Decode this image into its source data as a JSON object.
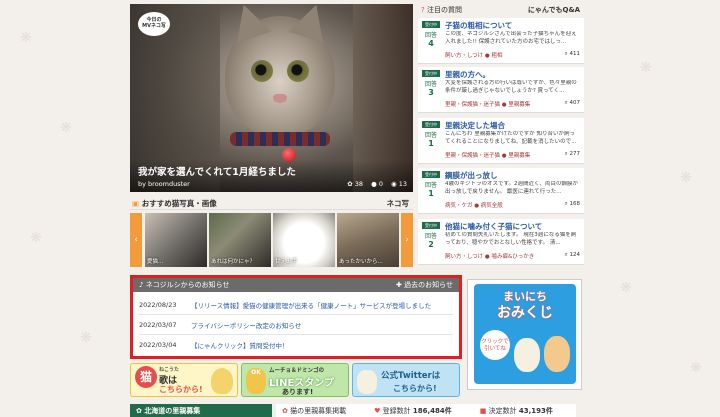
{
  "hero": {
    "badge_line1": "今日の",
    "badge_line2": "MVネコ写",
    "title": "我が家を選んでくれて1月経ちました",
    "author": "by broomduster",
    "likes": "38",
    "comments": "0",
    "views": "13"
  },
  "recommended": {
    "heading": "おすすめ猫写真・画像",
    "right_label": "ネコ写",
    "thumbs": [
      {
        "label": "愛猫..."
      },
      {
        "label": "あれは何かにゃ？"
      },
      {
        "label": "甘え上手"
      },
      {
        "label": "あったかいから..."
      }
    ]
  },
  "notice": {
    "heading": "ネコジルシからのお知らせ",
    "archive": "過去のお知らせ",
    "items": [
      {
        "date": "2022/08/23",
        "text": "【リリース情報】愛猫の健康管理が出来る「健康ノート」サービスが登場しました"
      },
      {
        "date": "2022/03/07",
        "text": "プライバシーポリシー改定のお知らせ"
      },
      {
        "date": "2022/03/04",
        "text": "【にゃんクリック】質問受付中！"
      }
    ]
  },
  "banners": {
    "b1_big": "猫",
    "b1_small": "ねこうた",
    "b1_line1": "歌は",
    "b1_line2": "こちらから!",
    "b2_line1": "ムーチョ＆ドミンゴの",
    "b2_line2": "LINEスタンプ",
    "b2_line3": "あります!",
    "b2_ok": "OK",
    "b3_line1": "公式Twitterは",
    "b3_line2": "こちらから!"
  },
  "bottom": {
    "area": "北海道の里親募集",
    "stat1_label": "猫の里親募集掲載",
    "stat2_label": "登録数計",
    "stat2_value": "186,484件",
    "stat3_label": "決定数計",
    "stat3_value": "43,193件"
  },
  "qa": {
    "heading": "注目の質問",
    "right_label": "にゃんでもQ&A",
    "status_label": "受付中",
    "answer_label": "回答",
    "items": [
      {
        "title": "子猫の粗相について",
        "body": "この度、ネコジルシさんで出会った子猫ちゃんを迎え入れました!! 保護されていた方のお宅ではしっ...",
        "category": "飼い方・しつけ ● 粗相",
        "answers": "4",
        "views": "411"
      },
      {
        "title": "里親の方へ。",
        "body": "大変を保護される方の行いは尊いですが、色々里親の条件が厳し過ぎじゃないでしょうか? 賞ってく...",
        "category": "里親・保護猫・迷子猫 ● 里親募集",
        "answers": "3",
        "views": "407"
      },
      {
        "title": "里親決定した場合",
        "body": "こんにちわ 里親募集かけたのですが 知り合いが飼ってくれることになりましてね、記載を消したいので...",
        "category": "里親・保護猫・迷子猫 ● 里親募集",
        "answers": "1",
        "views": "277"
      },
      {
        "title": "鋼膜が出っ放し",
        "body": "4歳のキジトラのオスです。2週間近く、両目の鋼膜が出っ放しで戻りません。 獣医に連れて行った...",
        "category": "病気・ケガ ● 病気全般",
        "answers": "1",
        "views": "168"
      },
      {
        "title": "他猫に噛み付く子猫について",
        "body": "初めての質問失礼いたします。 現在3週になる猫を飼っており、穏やかでおとなしい性格です。 清...",
        "category": "飼い方・しつけ ● 噛み癖&ひっかき",
        "answers": "2",
        "views": "124"
      }
    ]
  },
  "omikuji": {
    "line1": "まいにち",
    "line2": "おみくじ",
    "click_line1": "クリックで",
    "click_line2": "引いてね"
  }
}
